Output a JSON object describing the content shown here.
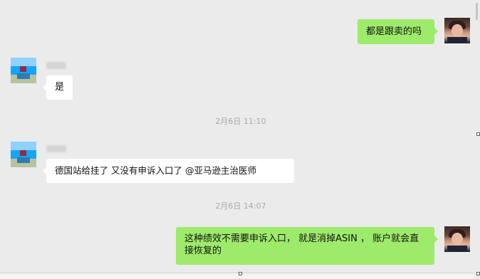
{
  "messages": [
    {
      "sender": "self",
      "text": "都是跟卖的吗"
    },
    {
      "sender": "other",
      "text": "是"
    },
    {
      "timestamp": "2月6日 11:10"
    },
    {
      "sender": "other",
      "text": "德国站给挂了  又没有申诉入口了  @亚马逊主治医师"
    },
    {
      "timestamp": "2月6日 14:07"
    },
    {
      "sender": "self",
      "text": "这种绩效不需要申诉入口， 就是消掉ASIN ， 账户就会直接恢复的"
    }
  ],
  "colors": {
    "chat_background": "#ebebeb",
    "self_bubble": "#9eea6a",
    "other_bubble": "#ffffff",
    "timestamp_text": "#a8a8a8"
  },
  "icons": {
    "self_avatar": "user-photo-avatar",
    "other_avatar": "pixelated-user-avatar"
  }
}
